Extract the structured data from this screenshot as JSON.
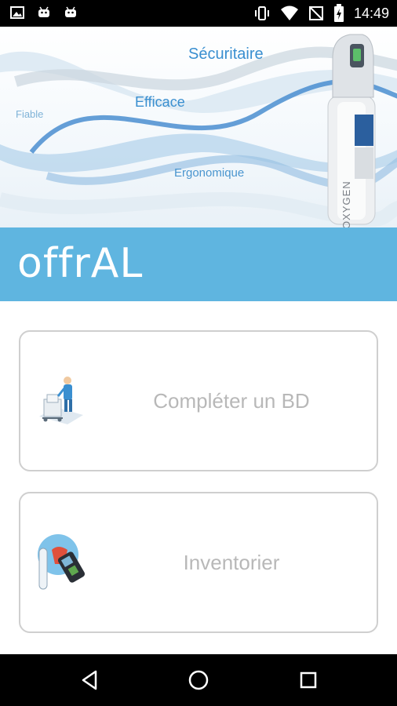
{
  "status_bar": {
    "time": "14:49",
    "left_icons": [
      "image-icon",
      "android-icon",
      "android-icon"
    ],
    "right_icons": [
      "vibrate-icon",
      "wifi-icon",
      "no-signal-icon",
      "battery-charging-icon"
    ]
  },
  "banner": {
    "taglines": {
      "securitaire": "Sécuritaire",
      "efficace": "Efficace",
      "fiable": "Fiable",
      "ergonomique": "Ergonomique"
    },
    "cylinder_label": "OXYGEN"
  },
  "brand": {
    "name": "offrAL",
    "color": "#5fb5e0"
  },
  "menu": {
    "items": [
      {
        "label": "Compléter un BD",
        "icon": "delivery-worker-icon"
      },
      {
        "label": "Inventorier",
        "icon": "scanner-icon"
      }
    ]
  },
  "nav_bar": {
    "buttons": [
      "back-icon",
      "home-icon",
      "recents-icon"
    ]
  }
}
